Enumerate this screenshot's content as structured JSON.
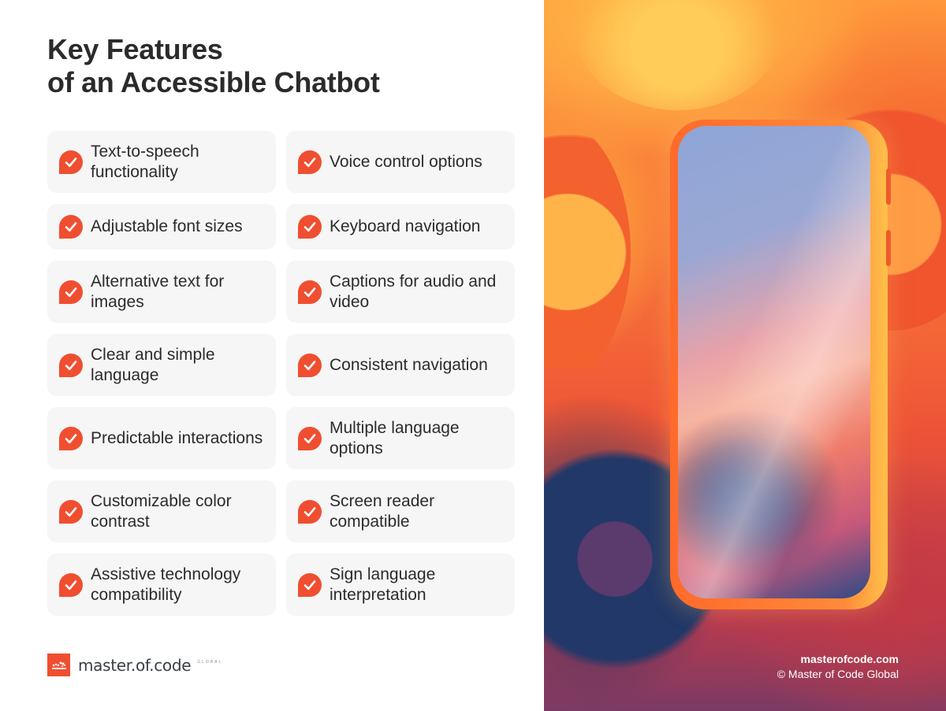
{
  "title": {
    "line1": "Key Features",
    "line2": "of an Accessible Chatbot"
  },
  "colors": {
    "accent": "#f04e30",
    "card_bg": "#f6f6f6",
    "text": "#2b2b2b"
  },
  "features": [
    {
      "label": "Text-to-speech functionality",
      "icon": "check-bubble-icon"
    },
    {
      "label": "Voice control options",
      "icon": "check-bubble-icon"
    },
    {
      "label": "Adjustable font sizes",
      "icon": "check-bubble-icon"
    },
    {
      "label": "Keyboard navigation",
      "icon": "check-bubble-icon"
    },
    {
      "label": "Alternative text for images",
      "icon": "check-bubble-icon"
    },
    {
      "label": "Captions for audio and video",
      "icon": "check-bubble-icon"
    },
    {
      "label": "Clear and simple language",
      "icon": "check-bubble-icon"
    },
    {
      "label": "Consistent navigation",
      "icon": "check-bubble-icon"
    },
    {
      "label": "Predictable interactions",
      "icon": "check-bubble-icon"
    },
    {
      "label": "Multiple language options",
      "icon": "check-bubble-icon"
    },
    {
      "label": "Customizable color contrast",
      "icon": "check-bubble-icon"
    },
    {
      "label": "Screen reader compatible",
      "icon": "check-bubble-icon"
    },
    {
      "label": "Assistive technology compatibility",
      "icon": "check-bubble-icon"
    },
    {
      "label": "Sign language interpretation",
      "icon": "check-bubble-icon"
    }
  ],
  "logo": {
    "text": "master.of.code",
    "sub": "GLOBAL"
  },
  "credit": {
    "site": "masterofcode.com",
    "copyright": "© Master of Code Global"
  },
  "illustration": {
    "subject": "smartphone among gears illustration"
  }
}
